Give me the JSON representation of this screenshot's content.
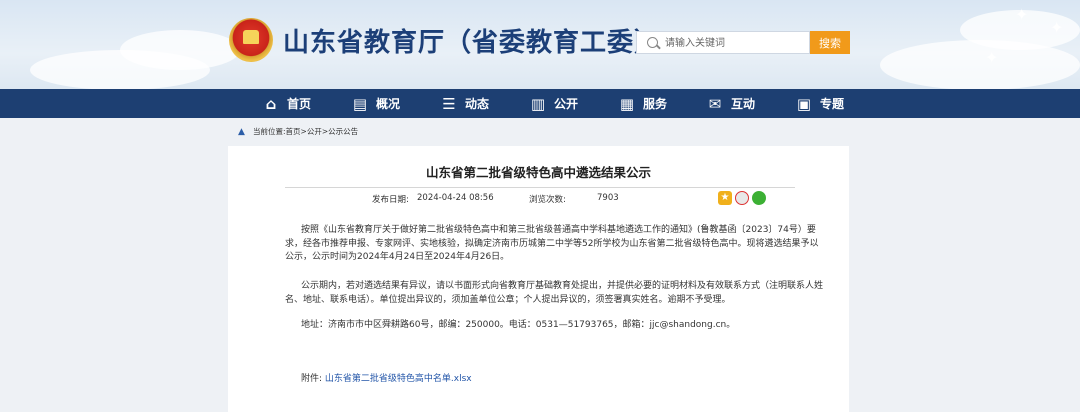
{
  "header": {
    "site_title": "山东省教育厅（省委教育工委）",
    "search": {
      "placeholder": "请输入关键词",
      "button": "搜索"
    }
  },
  "nav": [
    {
      "label": "首页",
      "icon": "home-icon"
    },
    {
      "label": "概况",
      "icon": "overview-icon"
    },
    {
      "label": "动态",
      "icon": "news-icon"
    },
    {
      "label": "公开",
      "icon": "book-icon"
    },
    {
      "label": "服务",
      "icon": "service-icon"
    },
    {
      "label": "互动",
      "icon": "chat-icon"
    },
    {
      "label": "专题",
      "icon": "topic-icon"
    }
  ],
  "breadcrumb": {
    "prefix": "当前位置:",
    "items": [
      "首页",
      "公开",
      "公示公告"
    ]
  },
  "article": {
    "title": "山东省第二批省级特色高中遴选结果公示",
    "publish_label": "发布日期:",
    "publish_date": "2024-04-24 08:56",
    "views_label": "浏览次数:",
    "views": "7903",
    "paragraphs": [
      "按照《山东省教育厅关于做好第二批省级特色高中和第三批省级普通高中学科基地遴选工作的通知》(鲁教基函〔2023〕74号）要求，经各市推荐申报、专家网评、实地核验，拟确定济南市历城第二中学等52所学校为山东省第二批省级特色高中。现将遴选结果予以公示，公示时间为2024年4月24日至2024年4月26日。",
      "公示期内，若对遴选结果有异议，请以书面形式向省教育厅基础教育处提出，并提供必要的证明材料及有效联系方式（注明联系人姓名、地址、联系电话）。单位提出异议的，须加盖单位公章；个人提出异议的，须签署真实姓名。逾期不予受理。",
      "地址：济南市市中区舜耕路60号，邮编：250000。电话：0531—51793765，邮箱：jjc@shandong.cn。"
    ],
    "attachment_label": "附件:",
    "attachment_name": "山东省第二批省级特色高中名单.xlsx"
  },
  "colors": {
    "nav_bg": "#1d3f72",
    "title_blue": "#1c3f78",
    "search_orange": "#f19a1a",
    "link_blue": "#2255a8"
  }
}
